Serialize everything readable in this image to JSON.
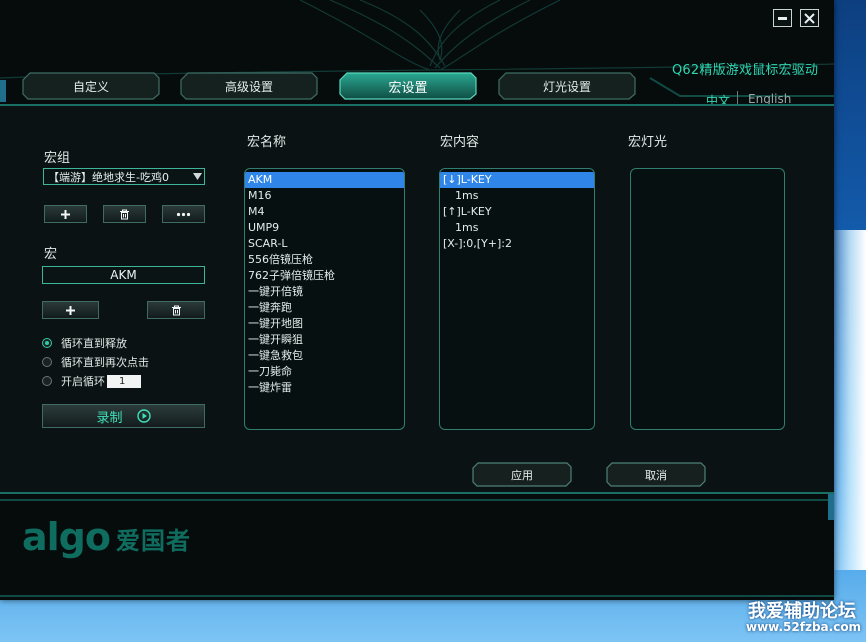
{
  "window": {
    "title": "Q62精版游戏鼠标宏驱动"
  },
  "language": {
    "zh": "中文",
    "en": "English"
  },
  "tabs": [
    {
      "label": "自定义",
      "active": false
    },
    {
      "label": "高级设置",
      "active": false
    },
    {
      "label": "宏设置",
      "active": true
    },
    {
      "label": "灯光设置",
      "active": false
    }
  ],
  "left": {
    "group_label": "宏组",
    "group_selected": "【端游】绝地求生-吃鸡0",
    "macro_label": "宏",
    "macro_name": "AKM",
    "loop_options": [
      {
        "label": "循环直到释放",
        "checked": true
      },
      {
        "label": "循环直到再次点击",
        "checked": false
      },
      {
        "label": "开启循环",
        "checked": false
      }
    ],
    "loop_count": "1",
    "record_label": "录制"
  },
  "columns": {
    "name_header": "宏名称",
    "content_header": "宏内容",
    "light_header": "宏灯光"
  },
  "macro_names": [
    "AKM",
    "M16",
    "M4",
    "UMP9",
    "SCAR-L",
    "556倍镜压枪",
    "762子弹倍镜压枪",
    "一键开倍镜",
    "一键奔跑",
    "一键开地图",
    "一键开瞬狙",
    "一键急救包",
    "一刀毙命",
    "一键炸雷"
  ],
  "macro_content": [
    {
      "text": "[↓]L-KEY",
      "indent": false
    },
    {
      "text": "1ms",
      "indent": true
    },
    {
      "text": "[↑]L-KEY",
      "indent": false
    },
    {
      "text": "1ms",
      "indent": true
    },
    {
      "text": "[X-]:0,[Y+]:2",
      "indent": false
    }
  ],
  "buttons": {
    "apply": "应用",
    "cancel": "取消"
  },
  "brand": {
    "logo": "algo",
    "logo_cn": "爱国者"
  },
  "watermark": {
    "line1": "我爱辅助论坛",
    "line2": "www.52fzba.com"
  },
  "colors": {
    "accent": "#2fd6b0",
    "selection": "#2f86e8",
    "border": "#2f7e70"
  }
}
